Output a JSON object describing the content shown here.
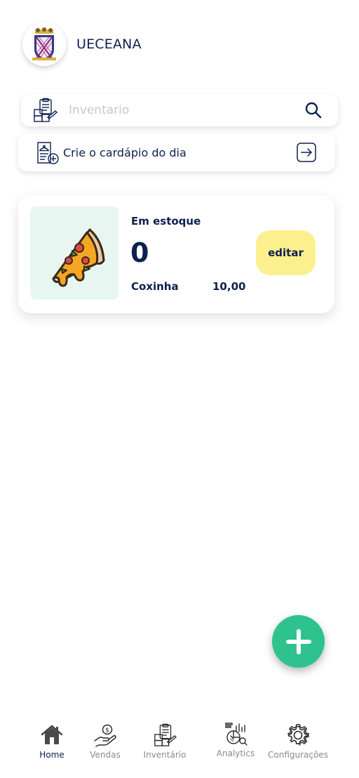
{
  "header": {
    "org_name": "UECEANA",
    "logo_icon": "university-crest-icon"
  },
  "search": {
    "placeholder": "Inventario",
    "left_icon": "inventory-icon",
    "right_icon": "search-icon"
  },
  "daily_menu": {
    "label": "Crie o cardápio do dia",
    "left_icon": "cloche-icon",
    "right_icon": "arrow-right-box-icon"
  },
  "product_card": {
    "stock_label": "Em estoque",
    "stock_value": "0",
    "name": "Coxinha",
    "price": "10,00",
    "edit_label": "editar",
    "image_icon": "pizza-slice-icon"
  },
  "fab": {
    "icon": "plus-icon"
  },
  "nav": {
    "items": [
      {
        "label": "Home",
        "icon": "home-icon",
        "active": true
      },
      {
        "label": "Vendas",
        "icon": "sales-hand-coin-icon",
        "active": false
      },
      {
        "label": "Inventário",
        "icon": "inventory-icon",
        "active": false
      },
      {
        "label": "Analytics",
        "icon": "analytics-icon",
        "active": false
      },
      {
        "label": "Configurações",
        "icon": "gear-icon",
        "active": false
      }
    ]
  },
  "colors": {
    "primary_text": "#0d2150",
    "accent_green": "#2ec28e",
    "edit_yellow": "#fcf08e",
    "image_bg": "#e8f6f1"
  }
}
